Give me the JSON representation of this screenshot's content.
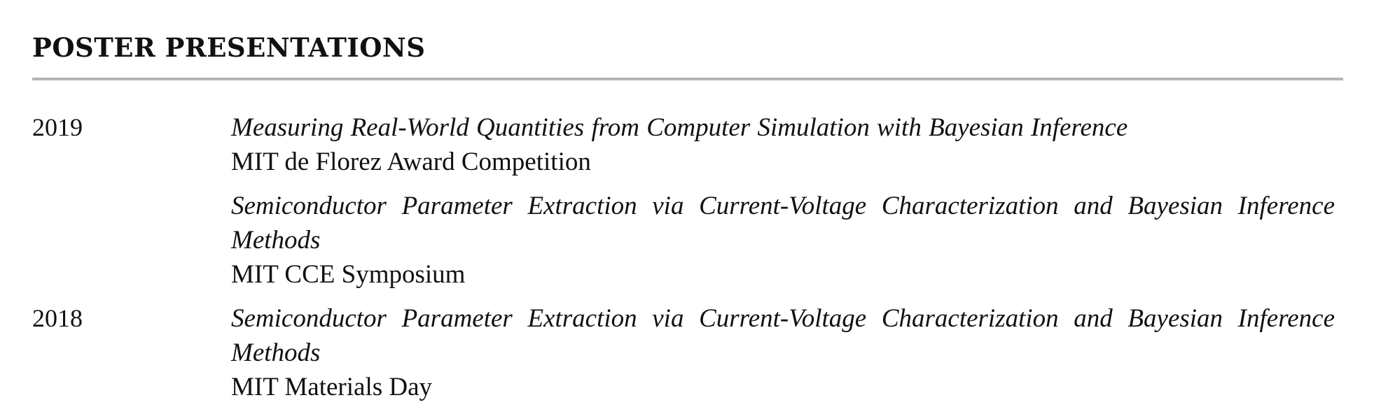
{
  "section": {
    "title": "POSTER PRESENTATIONS"
  },
  "entries": [
    {
      "year": "2019",
      "items": [
        {
          "title": "Measuring Real-World Quantities from Computer Simulation with Bayesian Inference",
          "venue": "MIT de Florez Award Competition"
        },
        {
          "title": "Semiconductor Parameter Extraction via Current-Voltage Characterization and Bayesian Inference Methods",
          "venue": "MIT CCE Symposium"
        }
      ]
    },
    {
      "year": "2018",
      "items": [
        {
          "title": "Semiconductor Parameter Extraction via Current-Voltage Characterization and Bayesian Inference Methods",
          "venue": "MIT Materials Day"
        }
      ]
    }
  ]
}
